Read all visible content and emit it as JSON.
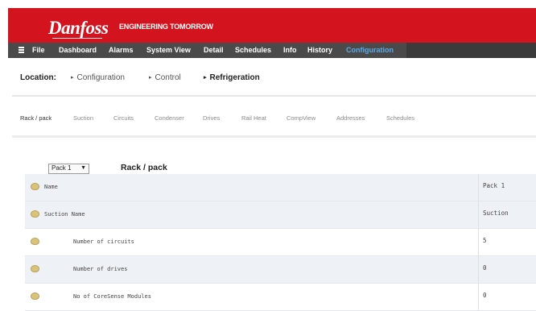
{
  "header": {
    "logo_text": "Danfoss",
    "tagline": "ENGINEERING TOMORROW",
    "brand_color": "#d3141f"
  },
  "menu": {
    "icon": "hamburger-menu-icon",
    "items": [
      "File",
      "Dashboard",
      "Alarms",
      "System View",
      "Detail",
      "Schedules",
      "Info",
      "History",
      "Configuration"
    ],
    "active": "Configuration"
  },
  "location": {
    "label": "Location:",
    "crumbs": [
      "Configuration",
      "Control",
      "Refrigeration"
    ]
  },
  "tabs": [
    "Rack / pack",
    "Suction",
    "Circuits",
    "Condenser",
    "Drives",
    "Rail Heat",
    "CompView",
    "Addresses",
    "Schedules"
  ],
  "selector": {
    "value": "Pack 1"
  },
  "section_title": "Rack / pack",
  "table": {
    "rows": [
      {
        "name": "Name",
        "value": "Pack 1"
      },
      {
        "name": "Suction Name",
        "value": "Suction"
      },
      {
        "name": "Number of circuits",
        "value": "5"
      },
      {
        "name": "Number of drives",
        "value": "0"
      },
      {
        "name": "No of CoreSense Modules",
        "value": "0"
      }
    ]
  }
}
